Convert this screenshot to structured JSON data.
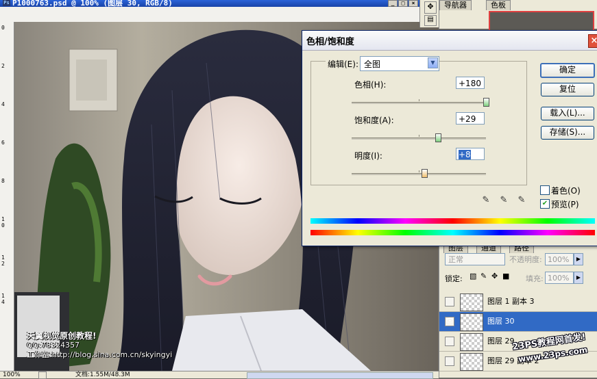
{
  "document": {
    "title": "P1000763.psd @ 100% (图层 30, RGB/8)",
    "ruler_top_ticks": [],
    "ruler_left_ticks": [
      "0",
      "2",
      "4",
      "6",
      "8",
      "1\n0",
      "1\n2",
      "1\n4"
    ],
    "status": {
      "zoom": "100%",
      "doc_size": "文档:1.55M/48.3M"
    },
    "watermark": {
      "line1": "天翼视觉原创教程!",
      "line2": "QQ:78324357",
      "line3": "工作室:http://blog.sina.com.cn/skyingyi"
    }
  },
  "navigator_panel": {
    "tabs": [
      "导航器",
      "色板"
    ]
  },
  "dialog": {
    "title": "色相/饱和度",
    "edit_label": "编辑(E):",
    "edit_value": "全图",
    "hue": {
      "label": "色相(H):",
      "value": "+180",
      "level": 1.0
    },
    "saturation": {
      "label": "饱和度(A):",
      "value": "+29",
      "level": 0.645
    },
    "lightness": {
      "label": "明度(I):",
      "value": "+8",
      "level": 0.54
    },
    "buttons": {
      "ok": "确定",
      "reset": "复位",
      "load": "载入(L)...",
      "save": "存储(S)..."
    },
    "colorize": {
      "label": "着色(O)",
      "checked": false
    },
    "preview": {
      "label": "预览(P)",
      "checked": true
    }
  },
  "layers_panel": {
    "tabs": [
      "图层",
      "通道",
      "路径"
    ],
    "blend_mode": "正常",
    "opacity_label": "不透明度:",
    "opacity_value": "100%",
    "lock_label": "锁定:",
    "fill_label": "填充:",
    "fill_value": "100%",
    "layers": [
      {
        "name": "图层 1 副本 3",
        "visible": false,
        "selected": false
      },
      {
        "name": "图层 30",
        "visible": true,
        "selected": true
      },
      {
        "name": "图层 29",
        "visible": false,
        "selected": false
      },
      {
        "name": "图层 29 副本 2",
        "visible": false,
        "selected": false
      }
    ]
  },
  "site_watermark": {
    "line1": "23PS教程网首发!",
    "line2": "www.23ps.com"
  },
  "colors": {
    "titlebar": "#1f4fc0",
    "selected_layer": "#316ac5",
    "dialog_bg": "#ece9d8"
  }
}
